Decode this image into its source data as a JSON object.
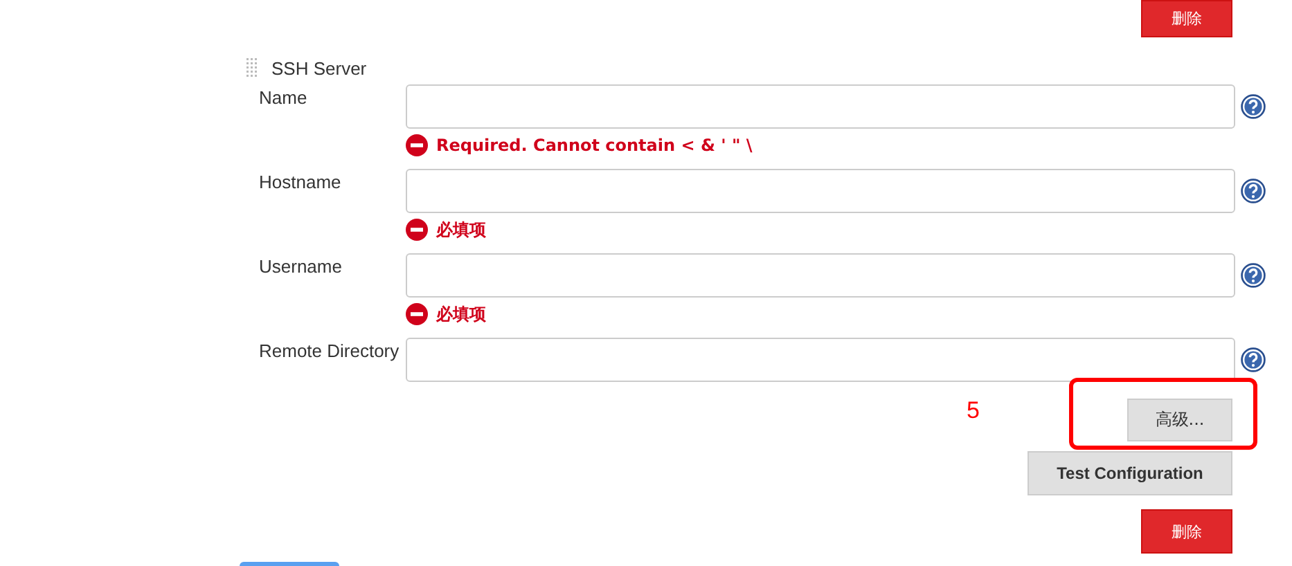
{
  "top_button": {
    "label": "删除"
  },
  "section": {
    "title": "SSH Server",
    "fields": [
      {
        "label": "Name",
        "error": "Required. Cannot contain < & ' \" \\"
      },
      {
        "label": "Hostname",
        "error": "必填项"
      },
      {
        "label": "Username",
        "error": "必填项"
      },
      {
        "label": "Remote Directory"
      }
    ]
  },
  "advanced_button": {
    "label": "高级..."
  },
  "annotation": {
    "label": "5"
  },
  "test_button": {
    "label": "Test Configuration"
  },
  "bottom_button": {
    "label": "删除"
  }
}
